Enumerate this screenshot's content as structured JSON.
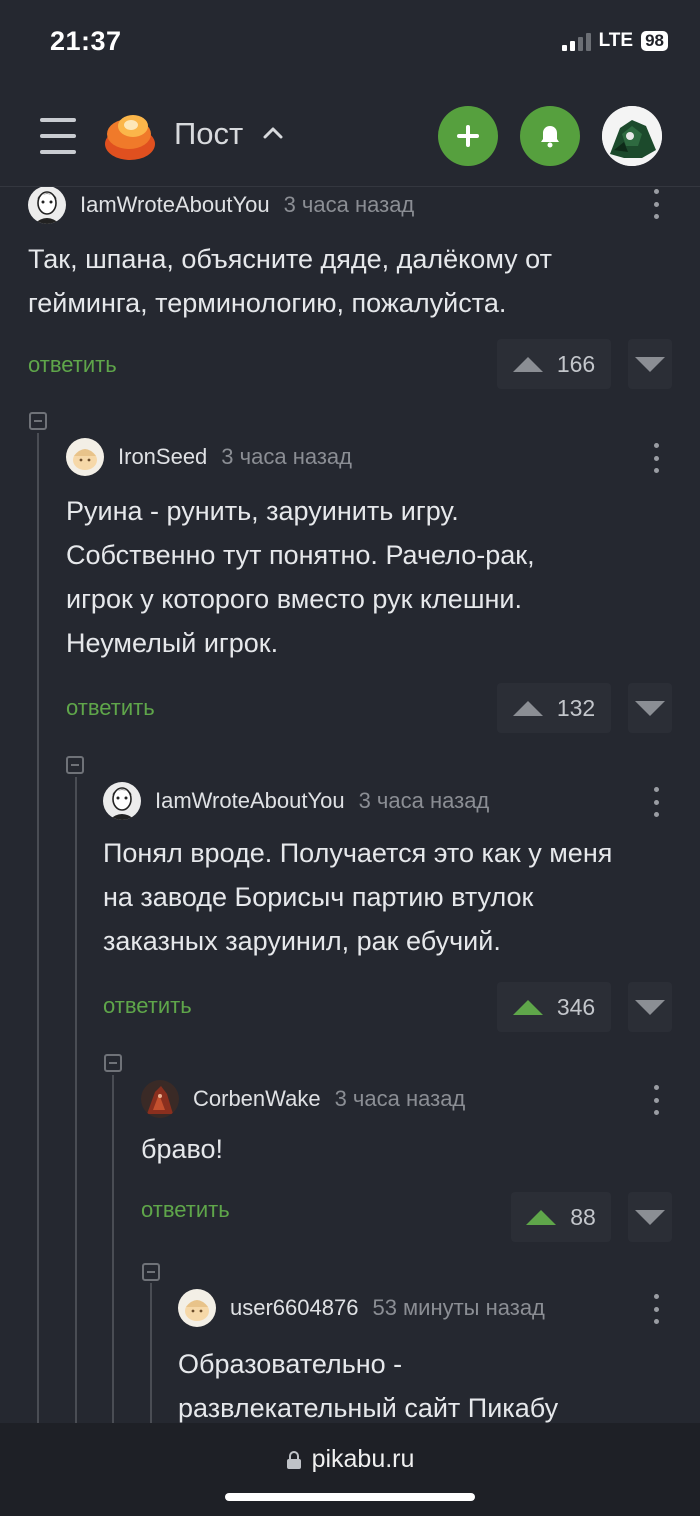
{
  "status": {
    "time": "21:37",
    "network": "LTE",
    "battery": "98"
  },
  "header": {
    "title": "Пост",
    "plus_icon": "plus-icon",
    "bell_icon": "bell-icon",
    "brand_color": "#56a03e"
  },
  "comments": [
    {
      "user": "IamWroteAboutYou",
      "time": "3 часа назад",
      "lines": [
        "Так, шпана, объясните дяде, далёкому от",
        "гейминга, терминологию, пожалуйста."
      ],
      "reply": "ответить",
      "rating": "166",
      "voted": false
    },
    {
      "user": "IronSeed",
      "time": "3 часа назад",
      "lines": [
        "Руина - рунить, заруинить игру.",
        "Собственно тут понятно. Рачело-рак,",
        "игрок у которого вместо рук клешни.",
        "Неумелый игрок."
      ],
      "reply": "ответить",
      "rating": "132",
      "voted": false
    },
    {
      "user": "IamWroteAboutYou",
      "time": "3 часа назад",
      "lines": [
        "Понял вроде. Получается это как у меня",
        "на заводе Борисыч партию втулок",
        "заказных заруинил, рак ебучий."
      ],
      "reply": "ответить",
      "rating": "346",
      "voted": true
    },
    {
      "user": "CorbenWake",
      "time": "3 часа назад",
      "lines": [
        "браво!"
      ],
      "reply": "ответить",
      "rating": "88",
      "voted": true
    },
    {
      "user": "user6604876",
      "time": "53 минуты назад",
      "lines": [
        "Образовательно -",
        "развлекательный сайт Пикабу"
      ],
      "reply": "",
      "rating": "",
      "voted": false
    }
  ],
  "footer": {
    "url": "pikabu.ru"
  }
}
